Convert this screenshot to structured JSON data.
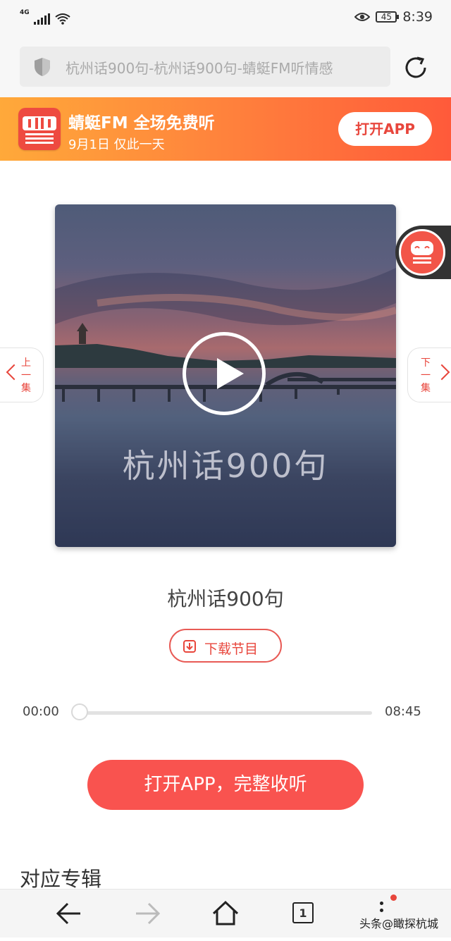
{
  "status_bar": {
    "network": "4G",
    "battery": "45",
    "time": "8:39"
  },
  "address_bar": {
    "url_text": "杭州话900句-杭州话900句-蜻蜓FM听情感"
  },
  "banner": {
    "title": "蜻蜓FM 全场免费听",
    "subtitle": "9月1日 仅此一天",
    "button_label": "打开APP"
  },
  "cover": {
    "caption": "杭州话900句"
  },
  "episode_nav": {
    "prev_label": "上一集",
    "next_label": "下一集"
  },
  "track": {
    "title": "杭州话900句",
    "download_label": "下载节目"
  },
  "player": {
    "current_time": "00:00",
    "duration": "08:45",
    "progress": 0
  },
  "cta": {
    "label": "打开APP，完整收听"
  },
  "section": {
    "title": "对应专辑"
  },
  "bottom_nav": {
    "tab_count": "1"
  },
  "watermark": "头条@瞰探杭城",
  "colors": {
    "accent": "#e8463c",
    "banner_start": "#ffa93a",
    "banner_end": "#ff5a3a",
    "cta": "#f9534f"
  }
}
